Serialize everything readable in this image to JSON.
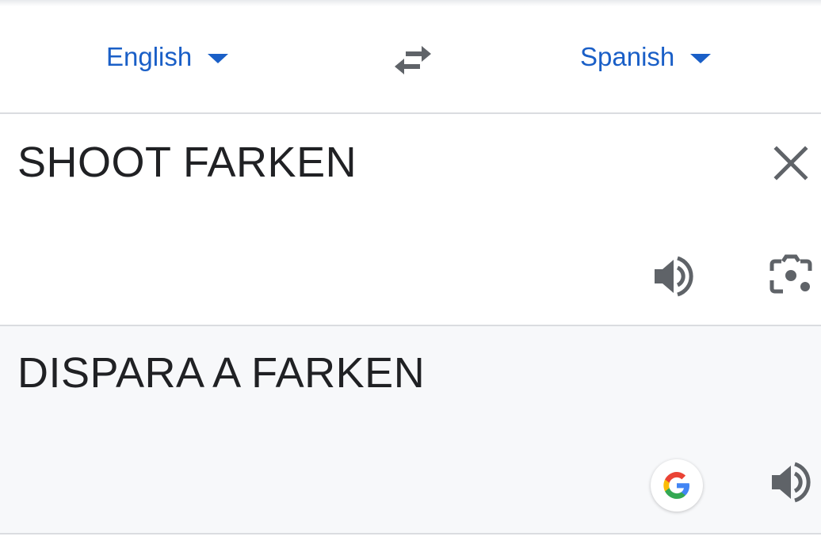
{
  "language_bar": {
    "source_language": "English",
    "target_language": "Spanish",
    "swap_icon": "swap-arrows-icon",
    "dropdown_icon": "caret-down-icon"
  },
  "source": {
    "text": "SHOOT FARKEN",
    "clear_icon": "close-icon",
    "speaker_icon": "speaker-icon",
    "camera_icon": "camera-lens-icon"
  },
  "translation": {
    "text": "DISPARA A FARKEN",
    "google_icon": "google-logo-icon",
    "speaker_icon": "speaker-icon"
  },
  "colors": {
    "accent": "#1a5fc7",
    "text": "#202124",
    "icon": "#5f6368",
    "divider": "#dadce0",
    "translation_bg": "#f7f8fa"
  }
}
